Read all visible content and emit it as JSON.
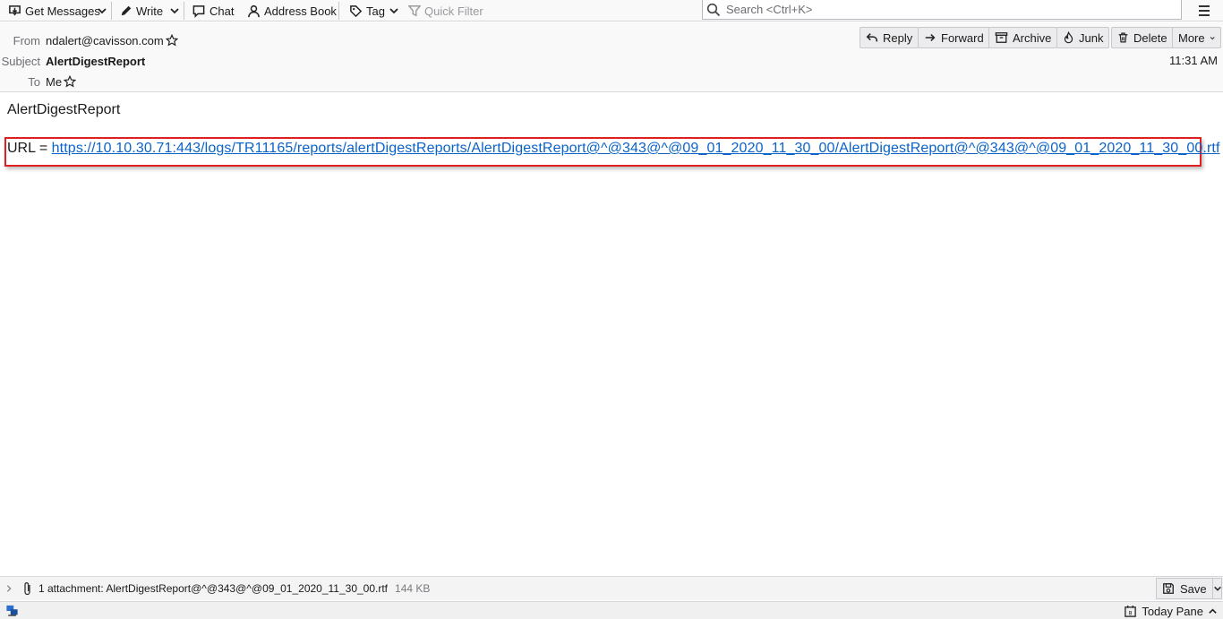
{
  "toolbar": {
    "get_messages": "Get Messages",
    "write": "Write",
    "chat": "Chat",
    "address_book": "Address Book",
    "tag": "Tag",
    "quick_filter": "Quick Filter",
    "search_placeholder": "Search <Ctrl+K>"
  },
  "header": {
    "from_label": "From",
    "from_value": "ndalert@cavisson.com",
    "subject_label": "Subject",
    "subject_value": "AlertDigestReport",
    "to_label": "To",
    "to_value": "Me",
    "time": "11:31 AM",
    "actions": {
      "reply": "Reply",
      "forward": "Forward",
      "archive": "Archive",
      "junk": "Junk",
      "delete": "Delete",
      "more": "More"
    }
  },
  "message": {
    "heading": "AlertDigestReport",
    "url_prefix": "URL = ",
    "url": "https://10.10.30.71:443/logs/TR11165/reports/alertDigestReports/AlertDigestReport@^@343@^@09_01_2020_11_30_00/AlertDigestReport@^@343@^@09_01_2020_11_30_00.rtf"
  },
  "attachment": {
    "label": "1 attachment: AlertDigestReport@^@343@^@09_01_2020_11_30_00.rtf",
    "size": "144 KB",
    "save": "Save"
  },
  "status": {
    "today_pane": "Today Pane"
  },
  "colors": {
    "link": "#0a63c9",
    "highlight_box": "#e02020"
  }
}
